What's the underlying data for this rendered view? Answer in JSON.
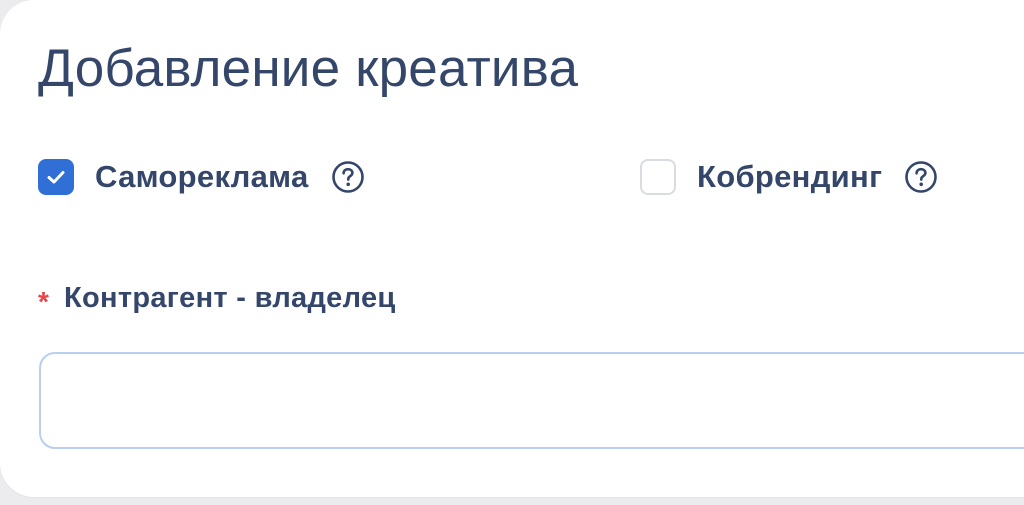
{
  "form": {
    "title": "Добавление креатива",
    "options": {
      "self_ad": {
        "label": "Самореклама",
        "checked": true,
        "help_icon": "question-circle-icon"
      },
      "cobranding": {
        "label": "Кобрендинг",
        "checked": false,
        "help_icon": "question-circle-icon"
      }
    },
    "owner_field": {
      "required_mark": "*",
      "label": "Контрагент - владелец",
      "value": "",
      "placeholder": ""
    }
  },
  "colors": {
    "text": "#34466a",
    "accent": "#2f6fd6",
    "required": "#e8454b",
    "input_border": "#b9cff0"
  }
}
